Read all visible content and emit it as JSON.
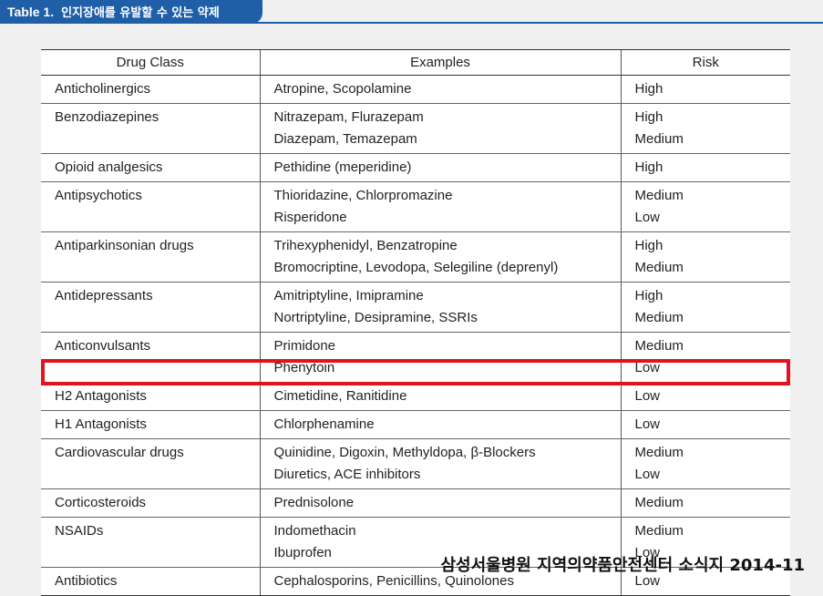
{
  "caption": {
    "table_number": "Table 1.",
    "title": "인지장애를 유발할 수 있는 약제"
  },
  "colors": {
    "caption_bg": "#1f5fa8",
    "highlight": "#e0141e"
  },
  "table": {
    "headers": [
      "Drug Class",
      "Examples",
      "Risk"
    ],
    "rows": [
      {
        "drug_class": "Anticholinergics",
        "examples": [
          "Atropine, Scopolamine"
        ],
        "risk": [
          "High"
        ]
      },
      {
        "drug_class": "Benzodiazepines",
        "examples": [
          "Nitrazepam, Flurazepam",
          "Diazepam, Temazepam"
        ],
        "risk": [
          "High",
          "Medium"
        ]
      },
      {
        "drug_class": "Opioid analgesics",
        "examples": [
          "Pethidine (meperidine)"
        ],
        "risk": [
          "High"
        ]
      },
      {
        "drug_class": "Antipsychotics",
        "examples": [
          "Thioridazine, Chlorpromazine",
          "Risperidone"
        ],
        "risk": [
          "Medium",
          "Low"
        ]
      },
      {
        "drug_class": "Antiparkinsonian drugs",
        "examples": [
          "Trihexyphenidyl, Benzatropine",
          "Bromocriptine, Levodopa, Selegiline (deprenyl)"
        ],
        "risk": [
          "High",
          "Medium"
        ]
      },
      {
        "drug_class": "Antidepressants",
        "examples": [
          "Amitriptyline, Imipramine",
          "Nortriptyline, Desipramine, SSRIs"
        ],
        "risk": [
          "High",
          "Medium"
        ]
      },
      {
        "drug_class": "Anticonvulsants",
        "examples": [
          "Primidone",
          "Phenytoin"
        ],
        "risk": [
          "Medium",
          "Low"
        ]
      },
      {
        "drug_class": "H2 Antagonists",
        "examples": [
          "Cimetidine, Ranitidine"
        ],
        "risk": [
          "Low"
        ],
        "highlighted": true
      },
      {
        "drug_class": "H1 Antagonists",
        "examples": [
          "Chlorphenamine"
        ],
        "risk": [
          "Low"
        ]
      },
      {
        "drug_class": "Cardiovascular drugs",
        "examples": [
          "Quinidine, Digoxin, Methyldopa, β-Blockers",
          "Diuretics, ACE inhibitors"
        ],
        "risk": [
          "Medium",
          "Low"
        ]
      },
      {
        "drug_class": "Corticosteroids",
        "examples": [
          "Prednisolone"
        ],
        "risk": [
          "Medium"
        ]
      },
      {
        "drug_class": "NSAIDs",
        "examples": [
          "Indomethacin",
          "Ibuprofen"
        ],
        "risk": [
          "Medium",
          "Low"
        ]
      },
      {
        "drug_class": "Antibiotics",
        "examples": [
          "Cephalosporins, Penicillins, Quinolones"
        ],
        "risk": [
          "Low"
        ]
      }
    ]
  },
  "footer": {
    "source": "삼성서울병원 지역의약품안전센터 소식지 2014-11"
  }
}
